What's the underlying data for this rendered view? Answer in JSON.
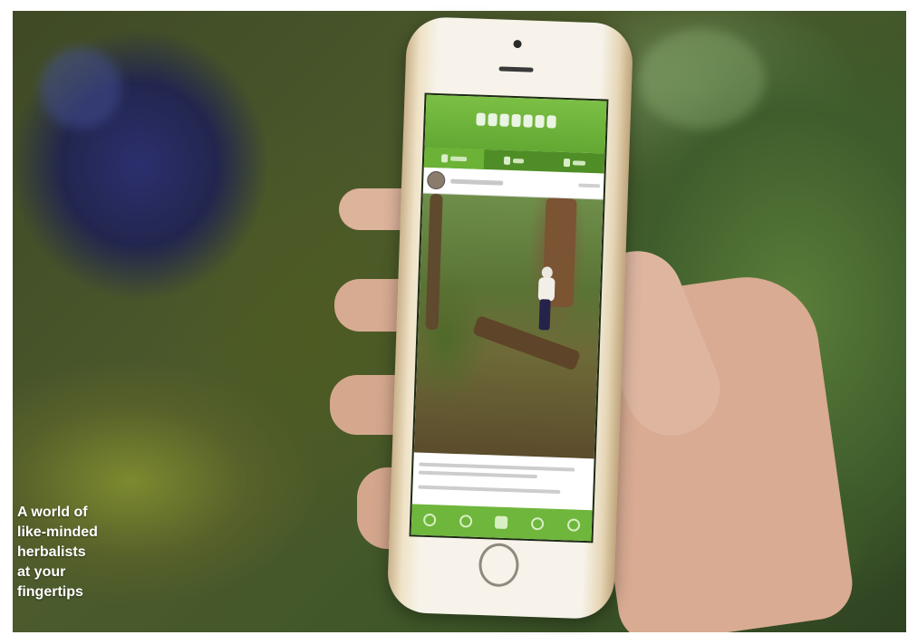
{
  "caption": {
    "lines": [
      "A world of",
      "like-minded",
      "herbalists",
      "at your",
      "fingertips"
    ]
  },
  "phone": {
    "color": "#efe2c6",
    "app": {
      "accent_color": "#6fb63c",
      "tab_icons": [
        "globe-icon",
        "person-icon",
        "location-icon"
      ],
      "nav_icons": [
        "home-icon",
        "search-icon",
        "camera-icon",
        "leaf-icon",
        "profile-icon"
      ]
    }
  }
}
